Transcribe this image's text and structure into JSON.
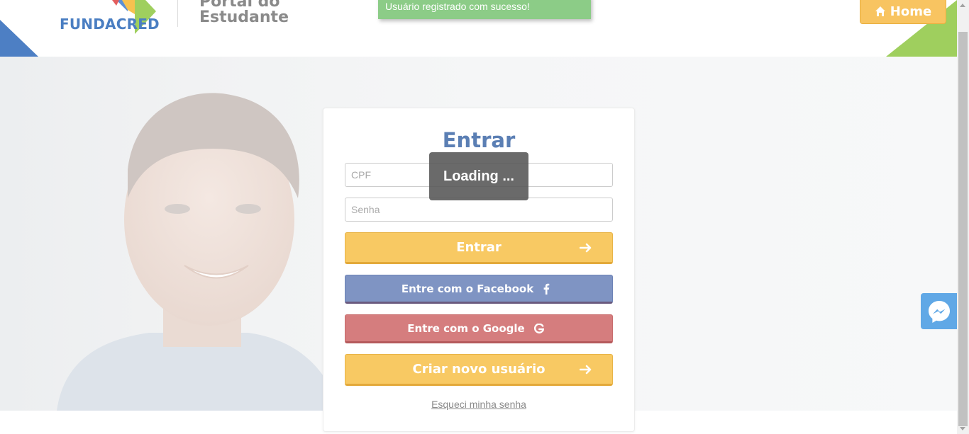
{
  "header": {
    "brand": "FUNDACRED",
    "portal_title_line1": "Portal do",
    "portal_title_line2": "Estudante",
    "home_label": "Home"
  },
  "toast": {
    "message": "Usuário registrado com sucesso!"
  },
  "login": {
    "title": "Entrar",
    "cpf_placeholder": "CPF",
    "password_placeholder": "Senha",
    "submit_label": "Entrar",
    "facebook_label": "Entre com o Facebook",
    "google_label": "Entre com o Google",
    "create_user_label": "Criar novo usuário",
    "forgot_password": "Esqueci minha senha"
  },
  "overlay": {
    "loading_text": "Loading ..."
  },
  "icons": {
    "home": "home-icon",
    "arrow": "arrow-right-icon",
    "facebook": "facebook-icon",
    "google": "google-icon",
    "messenger": "messenger-icon"
  },
  "colors": {
    "brand_blue": "#4a7ec2",
    "brand_green": "#9fcf5e",
    "accent_yellow": "#f8c963",
    "facebook": "#7f94c3",
    "google": "#d57d7e",
    "success": "#8ccc87",
    "messenger": "#60a8e6"
  }
}
